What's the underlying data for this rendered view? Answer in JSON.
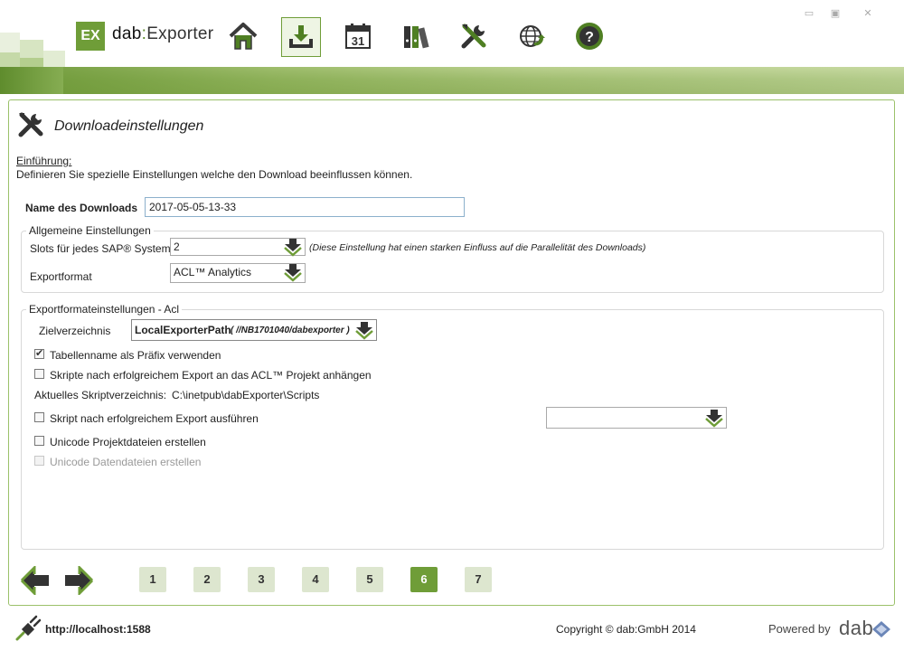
{
  "app": {
    "logo_badge": "EX",
    "logo_name": "dab",
    "logo_sep": ":",
    "logo_product": "Exporter",
    "accent_color": "#6f9d38"
  },
  "nav": [
    {
      "name": "home",
      "icon": "home-icon"
    },
    {
      "name": "download",
      "icon": "download-icon",
      "active": true
    },
    {
      "name": "calendar",
      "icon": "calendar-icon",
      "text": "31"
    },
    {
      "name": "library",
      "icon": "binders-icon"
    },
    {
      "name": "settings",
      "icon": "tools-icon"
    },
    {
      "name": "web",
      "icon": "globe-refresh-icon"
    },
    {
      "name": "help",
      "icon": "help-icon",
      "text": "?"
    }
  ],
  "window_controls": {
    "minimize": "▭",
    "maximize": "▣",
    "close": "✕"
  },
  "page": {
    "title": "Downloadeinstellungen",
    "intro_label": "Einführung:",
    "intro_text": "Definieren Sie spezielle Einstellungen welche den Download beeinflussen können."
  },
  "download_name": {
    "label": "Name des Downloads",
    "value": "2017-05-05-13-33"
  },
  "general": {
    "legend": "Allgemeine Einstellungen",
    "slots_label": "Slots für jedes SAP® System",
    "slots_value": "2",
    "slots_note": "(Diese Einstellung hat einen starken Einfluss auf die Parallelität des Downloads)",
    "format_label": "Exportformat",
    "format_value": "ACL™ Analytics"
  },
  "export_format": {
    "legend": "Exportformateinstellungen -  Acl",
    "target_label": "Zielverzeichnis",
    "target_value": "LocalExporterPath",
    "target_path": "( //NB1701040/dabexporter )",
    "cb_prefix": "Tabellenname als Präfix verwenden",
    "cb_prefix_checked": true,
    "cb_scripts_attach": "Skripte nach erfolgreichem Export an das ACL™ Projekt anhängen",
    "script_dir_label": "Aktuelles Skriptverzeichnis:",
    "script_dir_value": "C:\\inetpub\\dabExporter\\Scripts",
    "cb_run_script": "Skript nach erfolgreichem Export ausführen",
    "run_script_select": "",
    "cb_unicode_project": "Unicode Projektdateien erstellen",
    "cb_unicode_data": "Unicode Datendateien erstellen"
  },
  "pager": {
    "pages": [
      "1",
      "2",
      "3",
      "4",
      "5",
      "6",
      "7"
    ],
    "current": "6"
  },
  "footer": {
    "url": "http://localhost:1588",
    "copyright": "Copyright © dab:GmbH 2014",
    "powered_by": "Powered by",
    "brand": "dab"
  }
}
